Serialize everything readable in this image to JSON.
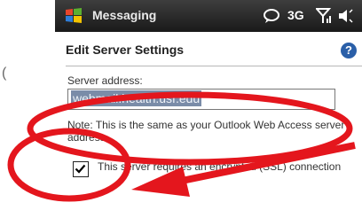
{
  "stray_char": "(",
  "titlebar": {
    "app_title": "Messaging",
    "icons": [
      "windows-start-icon",
      "message-icon",
      "signal-icon",
      "volume-icon"
    ],
    "network_type": "3G"
  },
  "page": {
    "heading": "Edit Server Settings",
    "help_glyph": "?",
    "server_address_label": "Server address:",
    "server_address_value": "webmail.health.usf.edu",
    "note": "Note: This is the same as your Outlook Web Access server address.",
    "ssl_checked": true,
    "ssl_label": "This server requires an encrypted (SSL) connection"
  },
  "colors": {
    "annotation": "#e4161d",
    "titlebar": "#2a2a2a",
    "selection": "#7a8ca8"
  }
}
